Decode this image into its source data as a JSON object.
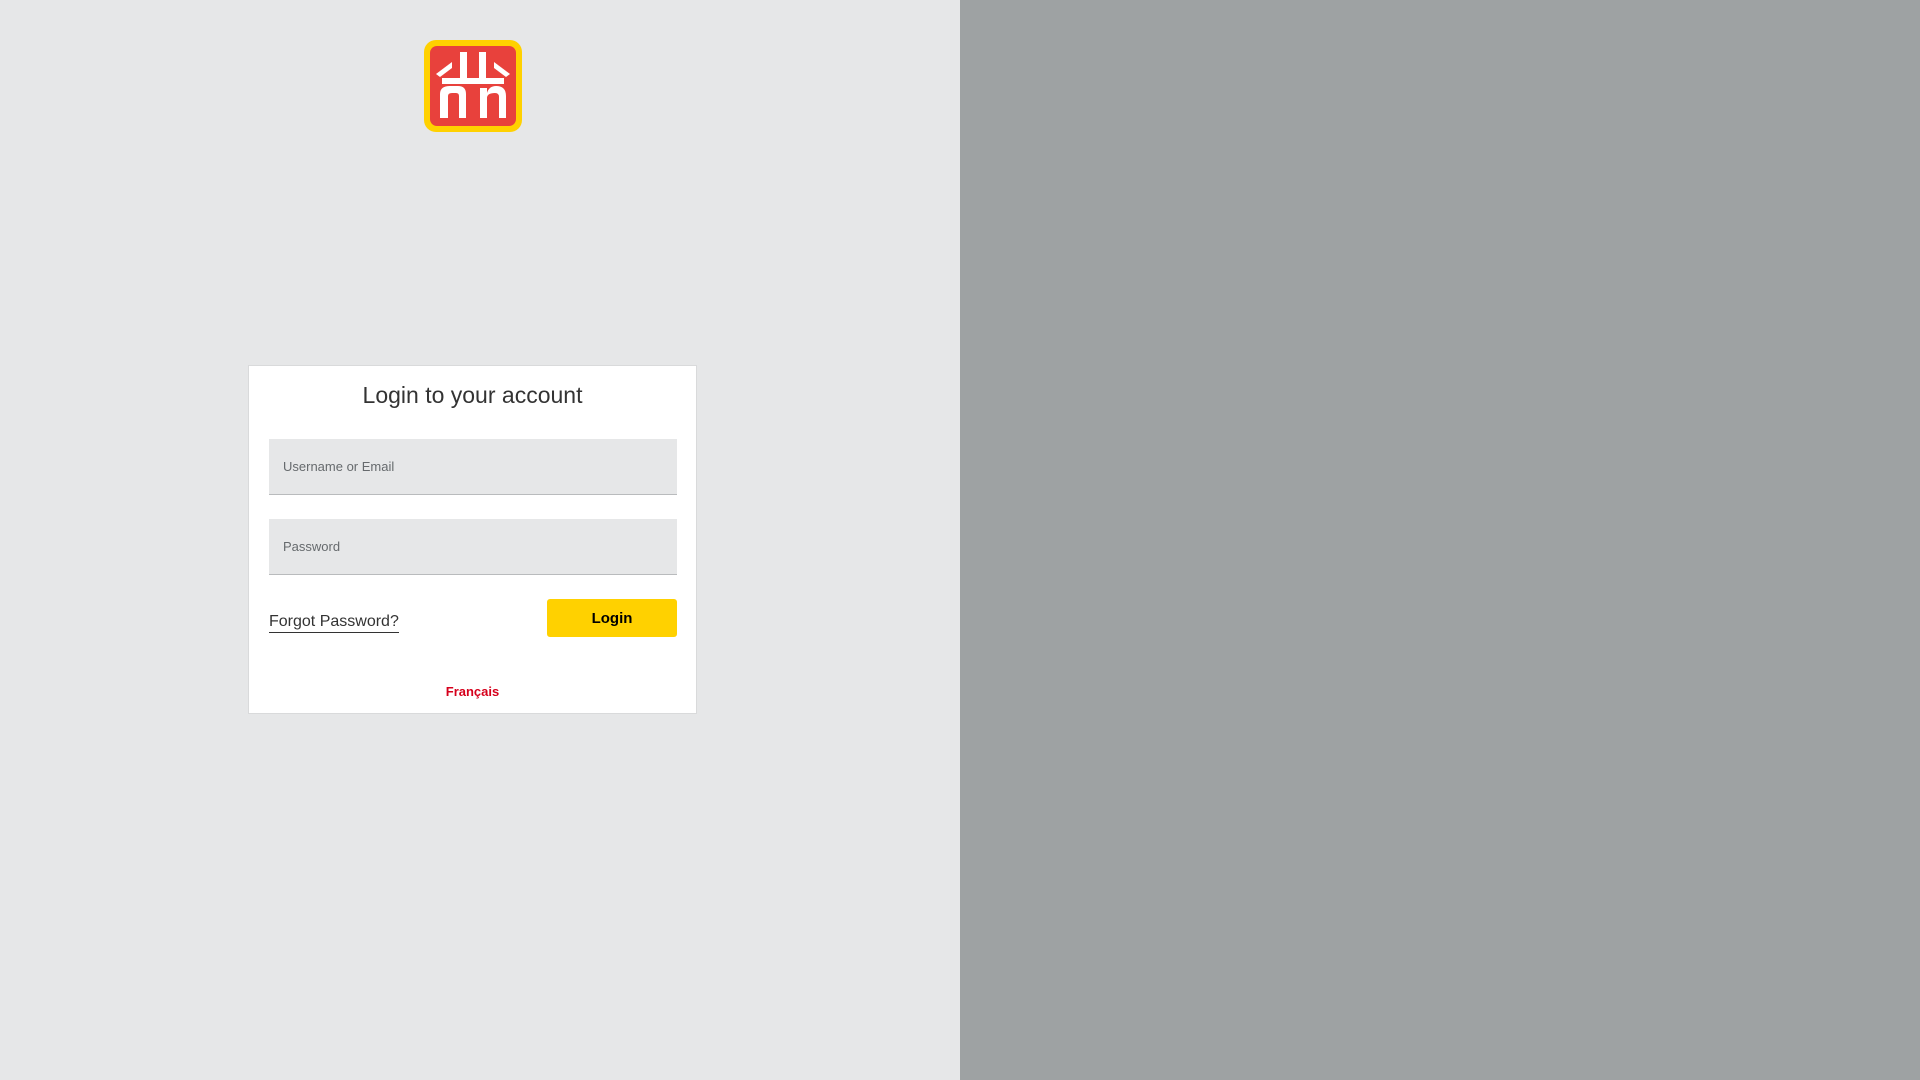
{
  "brand": {
    "logo_icon": "home-hardware-logo-icon",
    "colors": {
      "logo_yellow": "#ffd100",
      "logo_red": "#e8413c",
      "accent_yellow": "#ffd100",
      "link_red": "#d6001c",
      "left_bg": "#e6e7e8",
      "right_bg": "#9ea2a3"
    }
  },
  "login": {
    "title": "Login to your account",
    "username_placeholder": "Username or Email",
    "password_placeholder": "Password",
    "forgot_label": "Forgot Password?",
    "submit_label": "Login",
    "language_label": "Français"
  }
}
